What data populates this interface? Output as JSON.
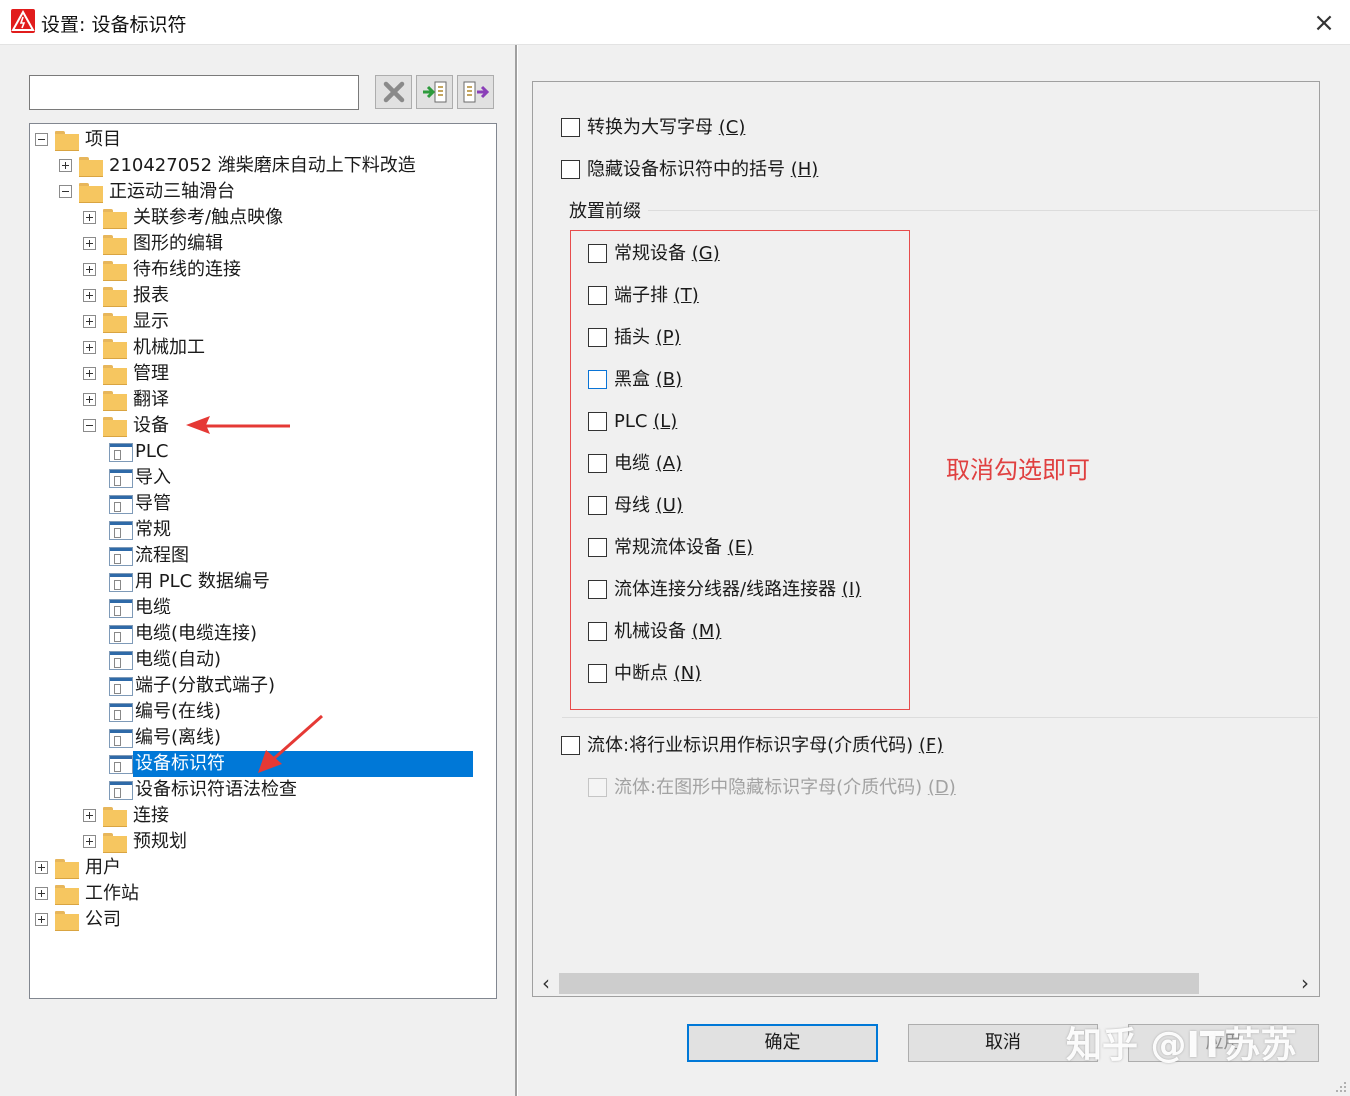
{
  "window": {
    "title": "设置: 设备标识符",
    "close_glyph": "×"
  },
  "toolbar": {
    "search_value": "",
    "buttons": [
      "delete",
      "import",
      "export"
    ]
  },
  "tree": {
    "nodes": [
      {
        "label": "项目",
        "level": 0,
        "state": "expanded",
        "icon": "folder-icon"
      },
      {
        "label": "210427052 潍柴磨床自动上下料改造",
        "level": 1,
        "state": "collapsed",
        "icon": "folder-icon"
      },
      {
        "label": "正运动三轴滑台",
        "level": 1,
        "state": "expanded",
        "icon": "folder-icon"
      },
      {
        "label": "关联参考/触点映像",
        "level": 2,
        "state": "collapsed",
        "icon": "folder-icon"
      },
      {
        "label": "图形的编辑",
        "level": 2,
        "state": "collapsed",
        "icon": "folder-icon"
      },
      {
        "label": "待布线的连接",
        "level": 2,
        "state": "collapsed",
        "icon": "folder-icon"
      },
      {
        "label": "报表",
        "level": 2,
        "state": "collapsed",
        "icon": "folder-icon"
      },
      {
        "label": "显示",
        "level": 2,
        "state": "collapsed",
        "icon": "folder-icon"
      },
      {
        "label": "机械加工",
        "level": 2,
        "state": "collapsed",
        "icon": "folder-icon"
      },
      {
        "label": "管理",
        "level": 2,
        "state": "collapsed",
        "icon": "folder-icon"
      },
      {
        "label": "翻译",
        "level": 2,
        "state": "collapsed",
        "icon": "folder-icon"
      },
      {
        "label": "设备",
        "level": 2,
        "state": "expanded",
        "icon": "folder-icon"
      },
      {
        "label": "PLC",
        "level": 3,
        "state": "leaf",
        "icon": "page-icon"
      },
      {
        "label": "导入",
        "level": 3,
        "state": "leaf",
        "icon": "page-icon"
      },
      {
        "label": "导管",
        "level": 3,
        "state": "leaf",
        "icon": "page-icon"
      },
      {
        "label": "常规",
        "level": 3,
        "state": "leaf",
        "icon": "page-icon"
      },
      {
        "label": "流程图",
        "level": 3,
        "state": "leaf",
        "icon": "page-icon"
      },
      {
        "label": "用 PLC 数据编号",
        "level": 3,
        "state": "leaf",
        "icon": "page-icon"
      },
      {
        "label": "电缆",
        "level": 3,
        "state": "leaf",
        "icon": "page-icon"
      },
      {
        "label": "电缆(电缆连接)",
        "level": 3,
        "state": "leaf",
        "icon": "page-icon"
      },
      {
        "label": "电缆(自动)",
        "level": 3,
        "state": "leaf",
        "icon": "page-icon"
      },
      {
        "label": "端子(分散式端子)",
        "level": 3,
        "state": "leaf",
        "icon": "page-icon"
      },
      {
        "label": "编号(在线)",
        "level": 3,
        "state": "leaf",
        "icon": "page-icon"
      },
      {
        "label": "编号(离线)",
        "level": 3,
        "state": "leaf",
        "icon": "page-icon"
      },
      {
        "label": "设备标识符",
        "level": 3,
        "state": "leaf",
        "icon": "page-icon",
        "selected": true
      },
      {
        "label": "设备标识符语法检查",
        "level": 3,
        "state": "leaf",
        "icon": "page-icon"
      },
      {
        "label": "连接",
        "level": 2,
        "state": "collapsed",
        "icon": "folder-icon"
      },
      {
        "label": "预规划",
        "level": 2,
        "state": "collapsed",
        "icon": "folder-icon"
      },
      {
        "label": "用户",
        "level": 0,
        "state": "collapsed",
        "icon": "folder-icon"
      },
      {
        "label": "工作站",
        "level": 0,
        "state": "collapsed",
        "icon": "folder-icon"
      },
      {
        "label": "公司",
        "level": 0,
        "state": "collapsed",
        "icon": "folder-icon"
      }
    ]
  },
  "settings": {
    "uppercase": {
      "text": "转换为大写字母 ",
      "key": "(C)",
      "checked": false
    },
    "hide_brackets": {
      "text": "隐藏设备标识符中的括号 ",
      "key": "(H)",
      "checked": false
    },
    "prefix_group_label": "放置前缀",
    "prefix_options": [
      {
        "text": "常规设备 ",
        "key": "(G)",
        "checked": false
      },
      {
        "text": "端子排 ",
        "key": "(T)",
        "checked": false
      },
      {
        "text": "插头 ",
        "key": "(P)",
        "checked": false
      },
      {
        "text": "黑盒 ",
        "key": "(B)",
        "checked": false,
        "hover": true
      },
      {
        "text": "PLC ",
        "key": "(L)",
        "checked": false
      },
      {
        "text": "电缆 ",
        "key": "(A)",
        "checked": false
      },
      {
        "text": "母线 ",
        "key": "(U)",
        "checked": false
      },
      {
        "text": "常规流体设备 ",
        "key": "(E)",
        "checked": false
      },
      {
        "text": "流体连接分线器/线路连接器 ",
        "key": "(I)",
        "checked": false
      },
      {
        "text": "机械设备 ",
        "key": "(M)",
        "checked": false
      },
      {
        "text": "中断点 ",
        "key": "(N)",
        "checked": false
      }
    ],
    "fluid_industry": {
      "text": "流体:将行业标识用作标识字母(介质代码) ",
      "key": "(F)",
      "checked": false
    },
    "fluid_hide": {
      "text": "流体:在图形中隐藏标识字母(介质代码) ",
      "key": "(D)",
      "checked": false,
      "disabled": true
    }
  },
  "annotation": {
    "text": "取消勾选即可",
    "color": "#e04040"
  },
  "buttons": {
    "ok": "确定",
    "cancel": "取消",
    "apply": "应用"
  },
  "watermark": "知乎 @IT苏苏",
  "colors": {
    "selection": "#0078d7",
    "highlight_box": "#e74c4c",
    "app_icon": "#e11c1c"
  }
}
